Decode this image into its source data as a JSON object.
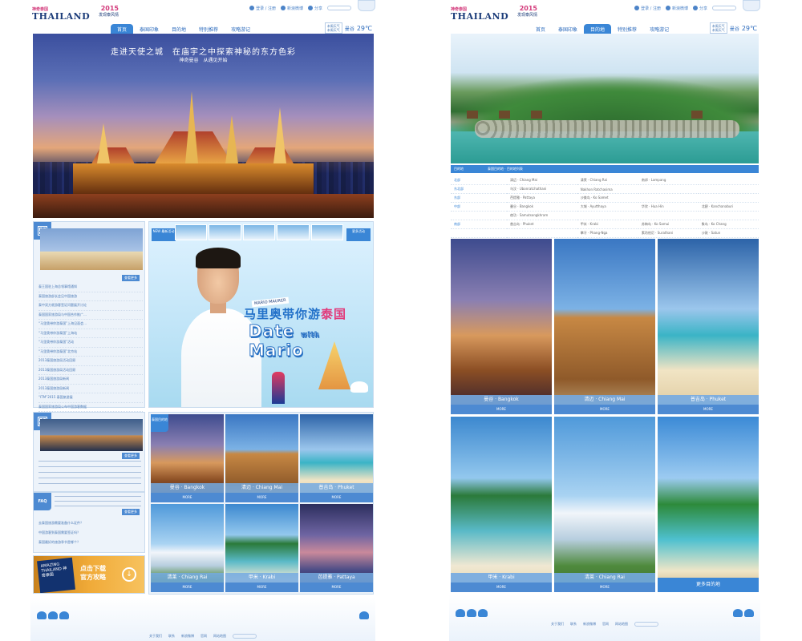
{
  "left": {
    "topbar": {
      "login": "登录 / 注册",
      "weibo": "新浪微博",
      "share": "分享"
    },
    "logo": {
      "brand": "神奇泰国",
      "name": "THAILAND",
      "slogan": "Amazing Thailand · It begins with the people"
    },
    "promo": {
      "year": "2015",
      "text": "发现泰风情"
    },
    "nav": [
      "首页",
      "泰国印象",
      "目的地",
      "特别推荐",
      "攻略游记"
    ],
    "weather": {
      "line1": "本周天气",
      "line2": "本周天气",
      "city": "曼谷",
      "temp": "29℃"
    },
    "hero": {
      "headline": "走进天使之城　在庙宇之中探索神秘的东方色彩",
      "sub": "神奇曼谷　从遇见开始"
    },
    "news": {
      "more": "查看更多",
      "items": [
        "泰王国驻上海总领事馆通知",
        "泰国旅游部长会见中国旅游",
        "泰中双方就游客签证问题展开讨论",
        "泰国国家旅游局与中国合作推广…",
        "“马里奥带你游泰国”上海见面会…",
        "“马里奥带你游泰国”上海站",
        "“马里奥带你游泰国”活动",
        "“马里奥带你游泰国”北京站",
        "2013泰国旅游局活动回顾",
        "2013泰国旅游局活动回顾",
        "2013泰国旅游局新闻",
        "2013泰国旅游局新闻",
        "“ITM”2015 泰国旅游展",
        "泰国国家旅游局公布中国游客数据"
      ]
    },
    "bangkok_panel": {
      "more": "查看更多"
    },
    "faq": {
      "tag": "FAQ",
      "more": "查看更多",
      "items": [
        "去泰国旅游需要准备什么证件？",
        "中国游客到泰国需要签证吗？",
        "泰国最好的旅游季节是哪个？"
      ]
    },
    "mario": {
      "badge_left": "NEW 最新活动",
      "badge_right": "更多活动",
      "caption": "MARIO MAURER",
      "title_cn_a": "马里奥带你游",
      "title_cn_b": "泰国",
      "title_en": "Date",
      "title_en_small": "with",
      "title_en_b": "Mario"
    },
    "dest_tag": "泰国目的地",
    "destinations": [
      {
        "label": "曼谷 · Bangkok",
        "more": "MORE",
        "img": "img-bangkok"
      },
      {
        "label": "清迈 · Chiang Mai",
        "more": "MORE",
        "img": "img-chiangmai"
      },
      {
        "label": "普吉岛 · Phuket",
        "more": "MORE",
        "img": "img-phuket"
      },
      {
        "label": "清莱 · Chiang Rai",
        "more": "MORE",
        "img": "img-chiangrai"
      },
      {
        "label": "甲米 · Krabi",
        "more": "MORE",
        "img": "img-krabi"
      },
      {
        "label": "芭提雅 · Pattaya",
        "more": "MORE",
        "img": "img-pattaya"
      }
    ],
    "download": {
      "book": "AMAZING THAILAND 神奇泰国",
      "line1": "点击下载",
      "line2": "官方攻略"
    },
    "footer": [
      "关于我们",
      "联系",
      "新浪微博",
      "官网",
      "网站地图"
    ]
  },
  "right": {
    "topbar": {
      "login": "登录 / 注册",
      "weibo": "新浪微博",
      "share": "分享"
    },
    "nav": [
      "首页",
      "泰国印象",
      "目的地",
      "特别推荐",
      "攻略游记"
    ],
    "breadcrumb": [
      "目的地",
      "泰国目的地 · 目的地列表"
    ],
    "regions": [
      {
        "name": "北部",
        "cols": [
          "清迈 · Chiang Mai",
          "清莱 · Chiang Rai",
          "南邦 · Lampang",
          ""
        ]
      },
      {
        "name": "东北部",
        "cols": [
          "乌汶 · Ubonratchathani",
          "Nakhon Ratchasima",
          "",
          ""
        ]
      },
      {
        "name": "东部",
        "cols": [
          "芭提雅 · Pattaya",
          "沙美岛 · Ko Samet",
          "",
          ""
        ]
      },
      {
        "name": "中部",
        "cols": [
          "曼谷 · Bangkok",
          "大城 · Ayutthaya",
          "华欣 · Hua Hin",
          "北碧 · Kanchanaburi"
        ]
      },
      {
        "name": "",
        "cols": [
          "夜功 · Samutsongkhram",
          "",
          "",
          ""
        ]
      },
      {
        "name": "南部",
        "cols": [
          "普吉岛 · Phuket",
          "甲米 · Krabi",
          "苏梅岛 · Ko Samui",
          "象岛 · Ko Chang"
        ]
      },
      {
        "name": "",
        "cols": [
          "",
          "攀牙 · Phang-Nga",
          "素叻他尼 · Surathani",
          "沙敦 · Satun"
        ]
      }
    ],
    "destinations": [
      {
        "label": "曼谷 · Bangkok",
        "more": "MORE",
        "img": "img-bangkok"
      },
      {
        "label": "清迈 · Chiang Mai",
        "more": "MORE",
        "img": "img-chiangmai"
      },
      {
        "label": "普吉岛 · Phuket",
        "more": "MORE",
        "img": "img-phuket"
      },
      {
        "label": "甲米 · Krabi",
        "more": "MORE",
        "img": "img-krabi"
      },
      {
        "label": "清莱 · Chiang Rai",
        "more": "MORE",
        "img": "img-chiangrai"
      },
      {
        "label": "更多目的地",
        "more": "",
        "img": "img-more"
      }
    ],
    "footer": [
      "关于我们",
      "联系",
      "新浪微博",
      "官网",
      "网站地图"
    ]
  }
}
